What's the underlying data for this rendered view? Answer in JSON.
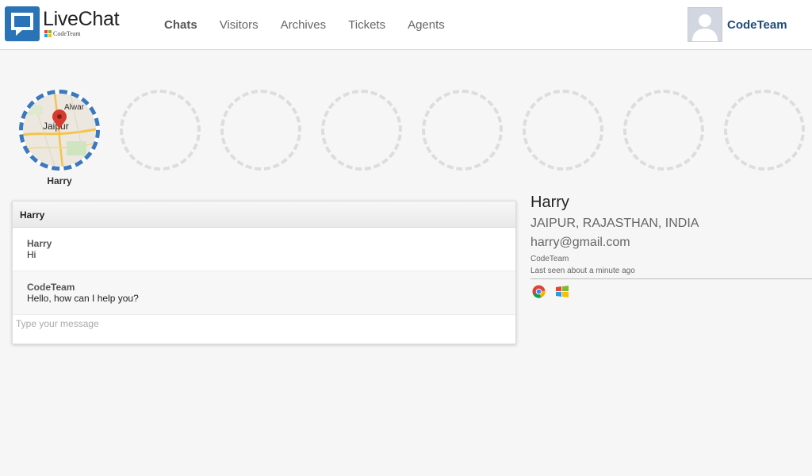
{
  "header": {
    "logo_title": "LiveChat",
    "logo_subtitle": "CodeTeam",
    "nav": [
      {
        "label": "Chats",
        "active": true
      },
      {
        "label": "Visitors",
        "active": false
      },
      {
        "label": "Archives",
        "active": false
      },
      {
        "label": "Tickets",
        "active": false
      },
      {
        "label": "Agents",
        "active": false
      }
    ],
    "user_name": "CodeTeam",
    "user_icon": "avatar-placeholder-icon"
  },
  "chats": {
    "active_label": "Harry",
    "map_labels": [
      "Jaipur",
      "Alwar"
    ],
    "empty_slots": 7
  },
  "chatbox": {
    "title": "Harry",
    "messages": [
      {
        "author": "Harry",
        "text": "Hi"
      },
      {
        "author": "CodeTeam",
        "text": "Hello, how can I help you?"
      }
    ],
    "input_placeholder": "Type your message"
  },
  "visitor": {
    "name": "Harry",
    "location": "JAIPUR, RAJASTHAN, INDIA",
    "email": "harry@gmail.com",
    "agent": "CodeTeam",
    "last_seen": "Last seen about a minute ago",
    "browser_icon": "chrome-icon",
    "os_icon": "windows-icon"
  },
  "colors": {
    "accent": "#3a78c0",
    "logo_blue": "#2a73b6",
    "user_name": "#1f4b7a",
    "background": "#f6f6f6"
  }
}
